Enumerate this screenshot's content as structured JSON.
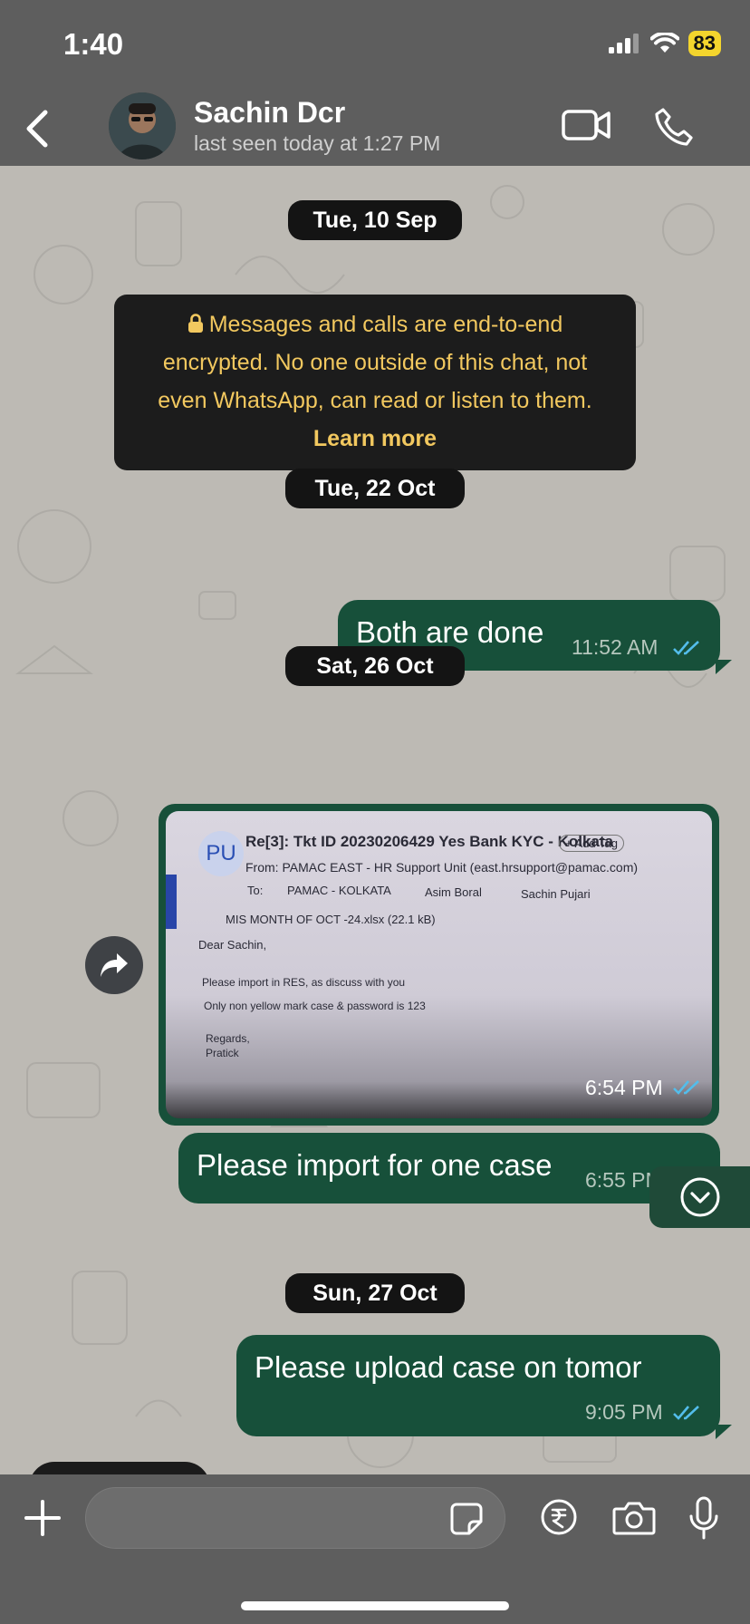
{
  "status_bar": {
    "time": "1:40",
    "battery": "83"
  },
  "header": {
    "contact_name": "Sachin Dcr",
    "last_seen": "last seen today at 1:27 PM"
  },
  "chat": {
    "dates": [
      "Tue, 10 Sep",
      "Tue, 22 Oct",
      "Sat, 26 Oct",
      "Sun, 27 Oct"
    ],
    "encryption_notice": {
      "lines": [
        "Messages and calls are end-to-end",
        "encrypted. No one outside of this chat, not",
        "even WhatsApp, can read or listen to them."
      ],
      "learn_more": "Learn more"
    },
    "messages": [
      {
        "text": "Both are done",
        "time": "11:52 AM"
      },
      {
        "type": "image",
        "time": "6:54 PM",
        "image_email": {
          "avatar": "PU",
          "subject": "Re[3]: Tkt ID 20230206429 Yes Bank KYC - Kolkata",
          "tag": "+ Add Tag",
          "from": "From:  PAMAC EAST - HR Support Unit (east.hrsupport@pamac.com)",
          "to_label": "To:",
          "to": [
            "PAMAC - KOLKATA",
            "Asim Boral",
            "Sachin Pujari"
          ],
          "attachment": "MIS MONTH OF OCT -24.xlsx  (22.1 kB)",
          "body": [
            "Dear Sachin,",
            "Please import in RES, as discuss with you",
            "Only non yellow mark case & password is 123",
            "Regards,",
            "Pratick"
          ]
        }
      },
      {
        "text": "Please import for one case",
        "time": "6:55 PM"
      },
      {
        "text": "Please upload case on tomor",
        "time": "9:05 PM"
      }
    ]
  },
  "composer": {
    "placeholder": ""
  },
  "colors": {
    "header_bg": "#5e5e5e",
    "chat_bg": "#bdbab4",
    "outgoing_bubble": "#17503a",
    "encryption_text": "#f2c85f",
    "read_ticks": "#53bdeb",
    "battery": "#f4d52d"
  },
  "icons": [
    "back-chevron-icon",
    "video-call-icon",
    "phone-icon",
    "lock-icon",
    "forward-icon",
    "chevron-down-icon",
    "plus-icon",
    "sticker-icon",
    "rupee-icon",
    "camera-icon",
    "microphone-icon"
  ]
}
